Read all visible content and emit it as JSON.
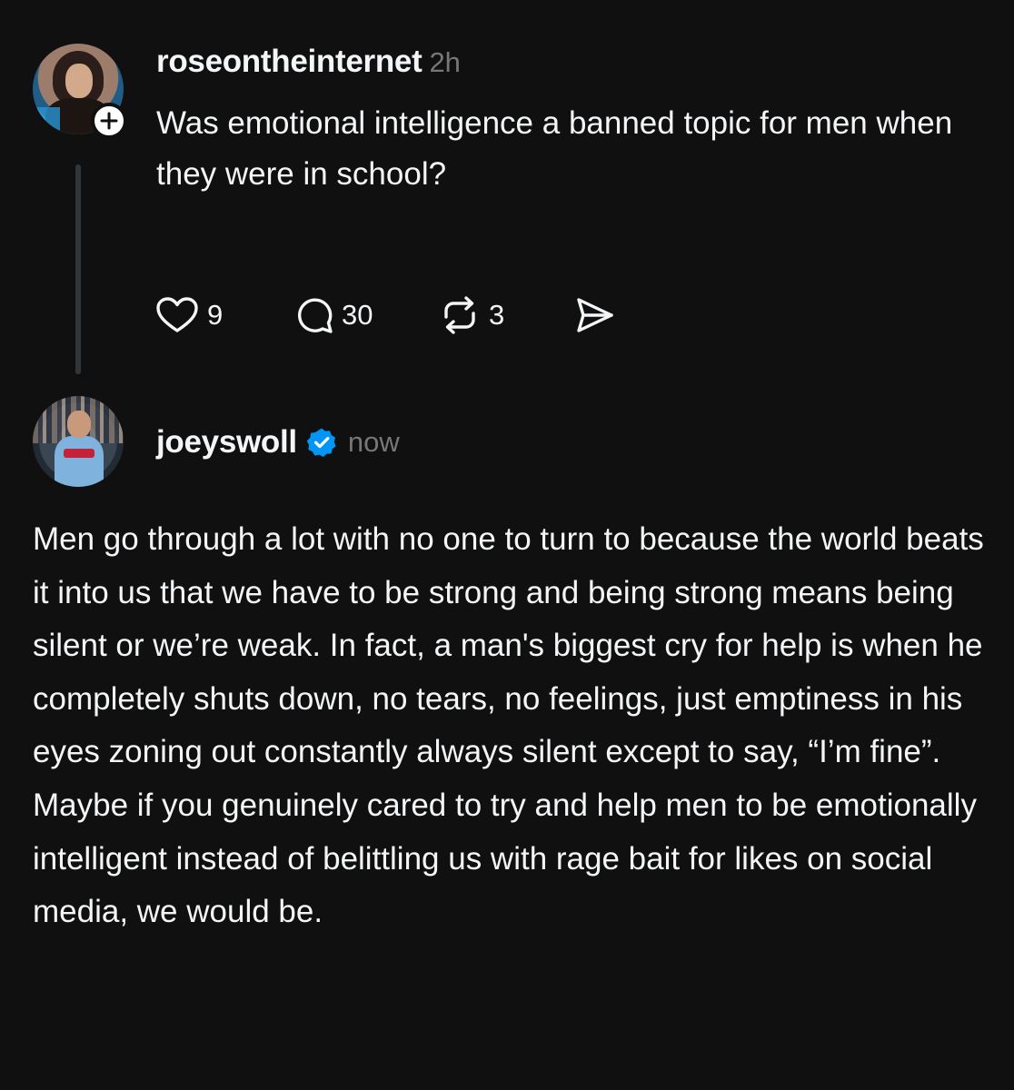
{
  "colors": {
    "background": "#101010",
    "text": "#f3f5f7",
    "muted": "#777777",
    "thread_line": "#333638",
    "verified_blue": "#0095f6"
  },
  "post": {
    "author": {
      "username": "roseontheinternet",
      "time": "2h",
      "avatar_icon": "profile-photo",
      "follow_icon": "plus-icon"
    },
    "text": "Was emotional intelligence a banned topic for men when they were in school?",
    "actions": {
      "like": {
        "icon": "heart-icon",
        "count": "9"
      },
      "reply": {
        "icon": "comment-icon",
        "count": "30"
      },
      "repost": {
        "icon": "repost-icon",
        "count": "3"
      },
      "share": {
        "icon": "send-icon"
      }
    }
  },
  "reply": {
    "author": {
      "username": "joeyswoll",
      "time": "now",
      "avatar_icon": "profile-photo",
      "verified_icon": "verified-badge-icon"
    },
    "text": "Men go through a lot with no one to turn to because the world beats it into us that we have to be strong and being strong means being silent or we’re weak. In fact, a man's biggest cry for help is when he completely shuts down, no tears, no feelings, just emptiness in his eyes zoning out constantly always silent except to say, “I’m fine”. Maybe if you genuinely cared to try and help men to be emotionally intelligent instead of belittling us with rage bait for likes on social media, we would be."
  }
}
